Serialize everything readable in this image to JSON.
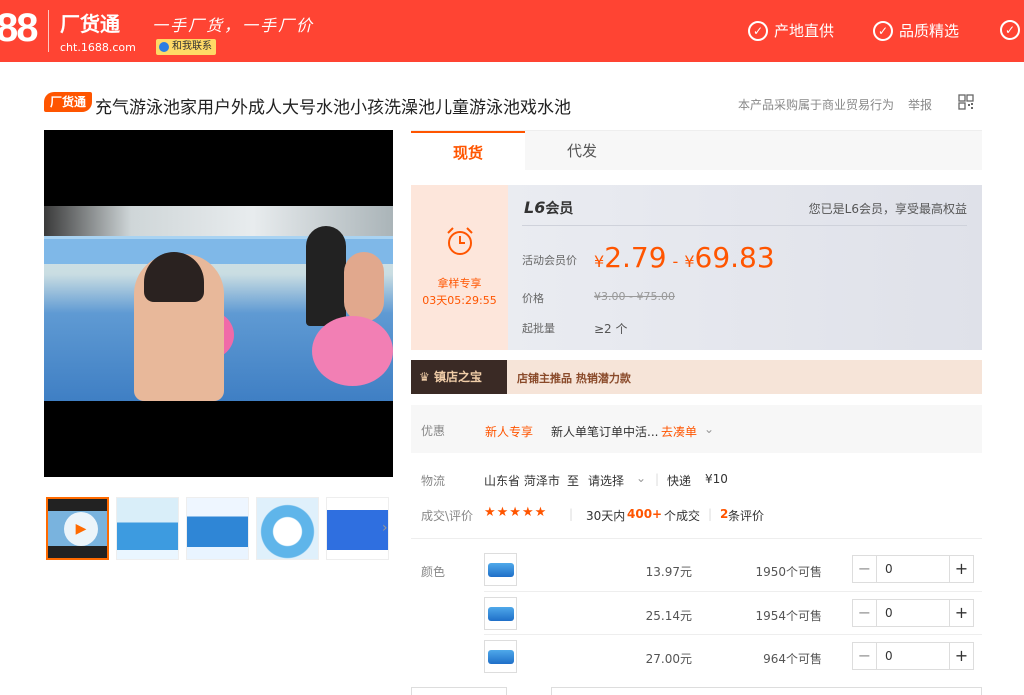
{
  "header": {
    "logo_number": "88",
    "brand": "厂货通",
    "brand_url": "cht.1688.com",
    "slogan": "一手厂货，一手厂价",
    "contact_label": "和我联系",
    "features": [
      "产地直供",
      "品质精选",
      ""
    ]
  },
  "product": {
    "badge": "厂货通",
    "title": "充气游泳池家用户外成人大号水池小孩洗澡池儿童游泳池戏水池",
    "trade_note": "本产品采购属于商业贸易行为",
    "report_label": "举报"
  },
  "tabs": [
    "现货",
    "代发"
  ],
  "price": {
    "promo_name": "拿样专享",
    "promo_time": "03天05:29:55",
    "member_level": "L6",
    "member_suffix": "会员",
    "member_note": "您已是L6会员，享受最高权益",
    "member_price_label": "活动会员价",
    "currency": "¥",
    "price_low": "2.79",
    "price_high": "69.83",
    "dash": "-",
    "orig_label": "价格",
    "orig_price": "¥3.00  -  ¥75.00",
    "min_label": "起批量",
    "min_qty": "≥2 个"
  },
  "store": {
    "badge": "镇店之宝",
    "text": "店铺主推品  热销潜力款"
  },
  "discount": {
    "label": "优惠",
    "tag": "新人专享",
    "text": "新人单笔订单中活...",
    "link": "去凑单"
  },
  "logistics": {
    "label": "物流",
    "from": "山东省 菏泽市",
    "to_word": "至",
    "select": "请选择",
    "method": "快递",
    "fee": "¥10"
  },
  "rating": {
    "label": "成交\\评价",
    "stars": "★★★★★",
    "days_text": "30天内",
    "count": "400+",
    "count_suffix": "个成交",
    "reviews": "2",
    "reviews_suffix": "条评价"
  },
  "sku": {
    "label": "颜色",
    "rows": [
      {
        "price": "13.97元",
        "stock": "1950个可售",
        "qty": "0"
      },
      {
        "price": "25.14元",
        "stock": "1954个可售",
        "qty": "0"
      },
      {
        "price": "27.00元",
        "stock": "964个可售",
        "qty": "0"
      }
    ],
    "minus": "−",
    "plus": "+"
  },
  "colors": {
    "accent": "#ff5500",
    "header": "#ff4433"
  }
}
